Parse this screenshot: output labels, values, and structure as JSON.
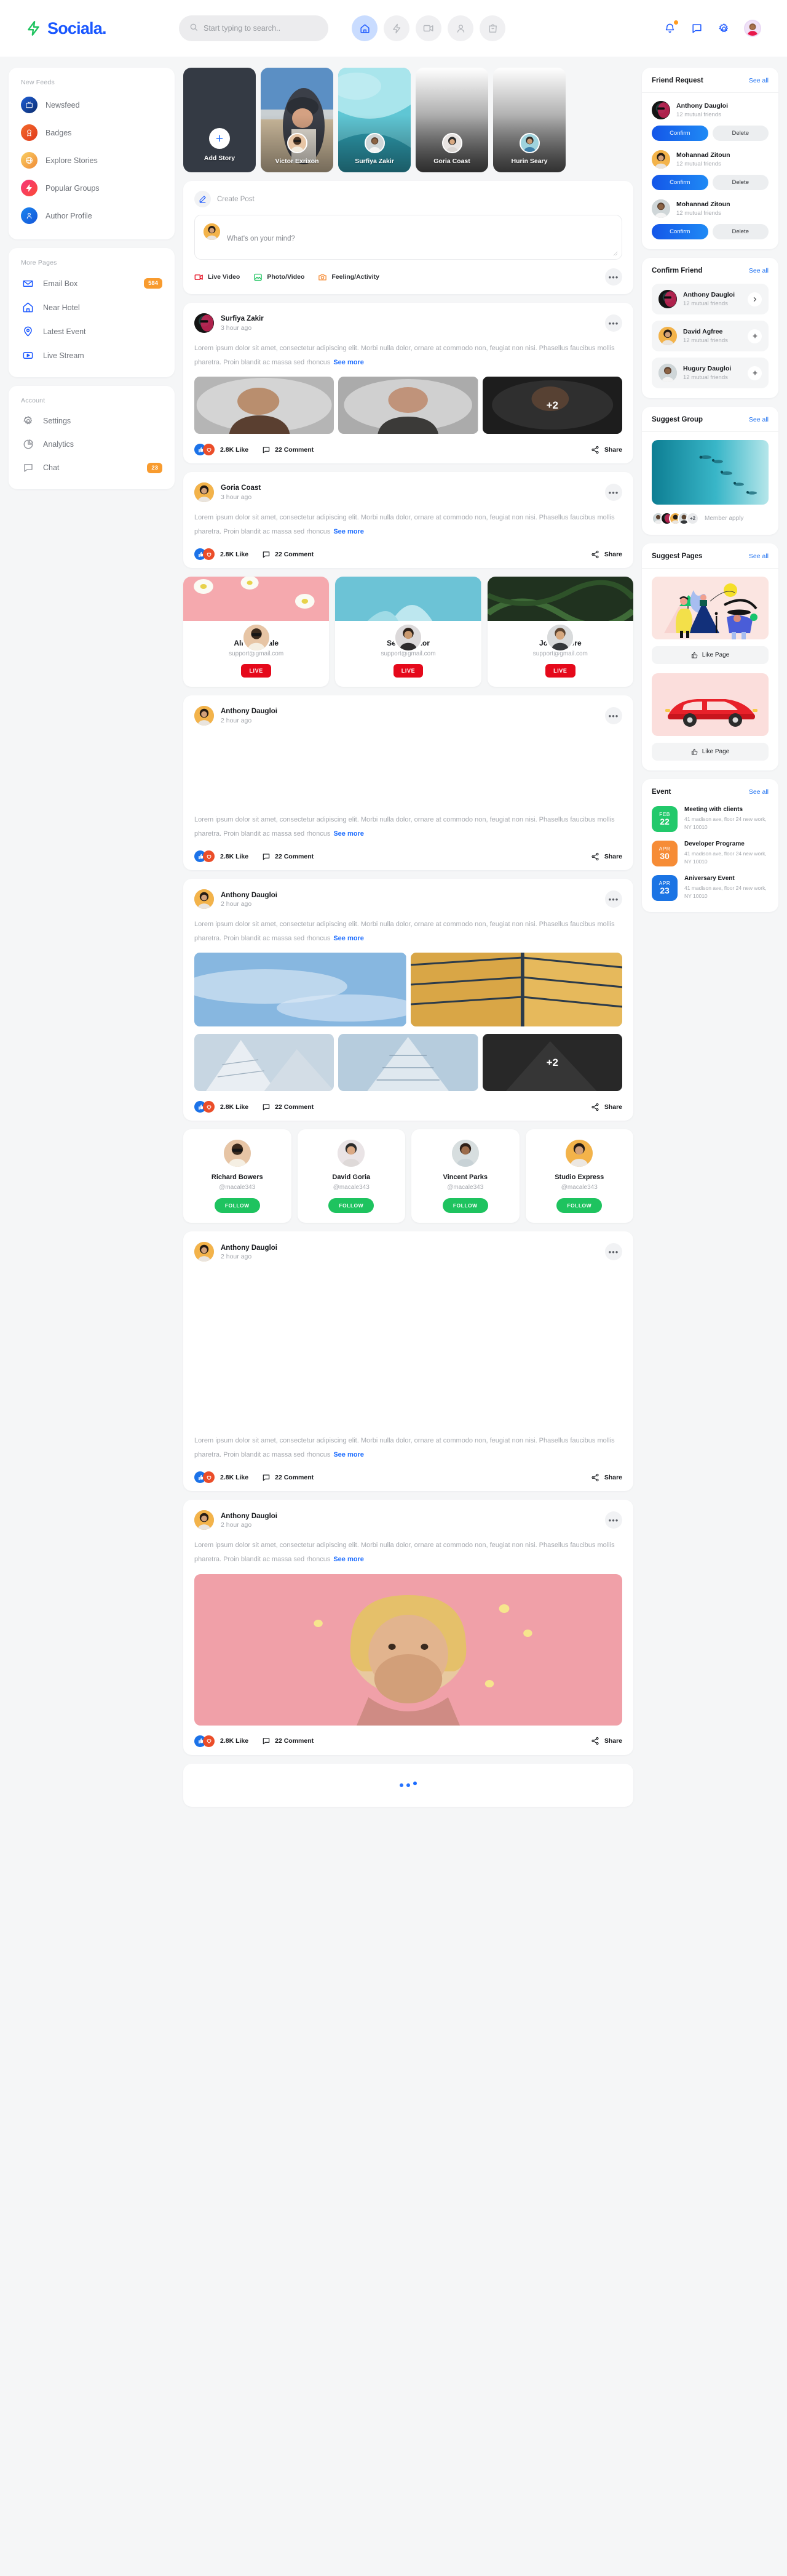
{
  "brand": {
    "name": "Sociala.",
    "logo_icon": "bolt-icon"
  },
  "search": {
    "placeholder": "Start typing to search..",
    "value": "",
    "icon": "search-icon"
  },
  "nav_icons": [
    {
      "name": "home-icon",
      "active": true
    },
    {
      "name": "bolt-icon",
      "active": false
    },
    {
      "name": "video-camera-icon",
      "active": false
    },
    {
      "name": "user-icon",
      "active": false
    },
    {
      "name": "shopping-bag-icon",
      "active": false
    }
  ],
  "header_right": [
    {
      "name": "bell-icon",
      "has_badge": true
    },
    {
      "name": "chat-bubble-icon",
      "has_badge": false
    },
    {
      "name": "gear-icon",
      "has_badge": false
    },
    {
      "name": "profile-avatar",
      "has_badge": false
    }
  ],
  "sidebar": {
    "groups": [
      {
        "title": "New Feeds",
        "items": [
          {
            "label": "Newsfeed",
            "icon": "tv-icon",
            "style": "g-blue"
          },
          {
            "label": "Badges",
            "icon": "award-icon",
            "style": "g-red"
          },
          {
            "label": "Explore Stories",
            "icon": "globe-icon",
            "style": "g-amber"
          },
          {
            "label": "Popular Groups",
            "icon": "bolt-icon",
            "style": "g-pink"
          },
          {
            "label": "Author Profile",
            "icon": "user-icon",
            "style": "g-sky"
          }
        ]
      },
      {
        "title": "More Pages",
        "items": [
          {
            "label": "Email Box",
            "icon": "inbox-icon",
            "count": "584"
          },
          {
            "label": "Near Hotel",
            "icon": "home-icon",
            "count": ""
          },
          {
            "label": "Latest Event",
            "icon": "map-pin-icon",
            "count": ""
          },
          {
            "label": "Live Stream",
            "icon": "play-video-icon",
            "count": ""
          }
        ]
      },
      {
        "title": "Account",
        "items": [
          {
            "label": "Settings",
            "icon": "gear-icon",
            "count": ""
          },
          {
            "label": "Analytics",
            "icon": "pie-chart-icon",
            "count": ""
          },
          {
            "label": "Chat",
            "icon": "chat-bubble-icon",
            "count": "23"
          }
        ]
      }
    ]
  },
  "stories": [
    {
      "name": "Add Story",
      "type": "add",
      "icon": "plus-icon"
    },
    {
      "name": "Victor Exrixon",
      "type": "story",
      "cover": "beach"
    },
    {
      "name": "Surfiya Zakir",
      "type": "story",
      "cover": "wave"
    },
    {
      "name": "Goria Coast",
      "type": "story",
      "cover": "light"
    },
    {
      "name": "Hurin Seary",
      "type": "story",
      "cover": "light2"
    }
  ],
  "create_post": {
    "title": "Create Post",
    "pen_icon": "pencil-icon",
    "placeholder": "What's on your mind?",
    "value": "",
    "actions": [
      {
        "label": "Live Video",
        "icon": "video-camera-icon",
        "color": "#e5091b"
      },
      {
        "label": "Photo/Video",
        "icon": "image-icon",
        "color": "#1ec35f"
      },
      {
        "label": "Feeling/Activity",
        "icon": "camera-icon",
        "color": "#f68c36"
      }
    ],
    "more_icon": "ellipsis-icon"
  },
  "posts": [
    {
      "author": "Surfiya Zakir",
      "time": "3 hour ago",
      "text": "Lorem ipsum dolor sit amet, consectetur adipiscing elit. Morbi nulla dolor, ornare at commodo non, feugiat non nisi. Phasellus faucibus mollis pharetra. Proin blandit ac massa sed rhoncus",
      "see_more": "See more",
      "media_type": "three",
      "extra_count": "+2",
      "likes": "2.8K Like",
      "comments": "22 Comment",
      "share": "Share"
    },
    {
      "author": "Goria Coast",
      "time": "3 hour ago",
      "text": "Lorem ipsum dolor sit amet, consectetur adipiscing elit. Morbi nulla dolor, ornare at commodo non, feugiat non nisi. Phasellus faucibus mollis pharetra. Proin blandit ac massa sed rhoncus",
      "see_more": "See more",
      "media_type": "none",
      "extra_count": "",
      "likes": "2.8K Like",
      "comments": "22 Comment",
      "share": "Share"
    },
    {
      "author": "Anthony Daugloi",
      "time": "2 hour ago",
      "text": "Lorem ipsum dolor sit amet, consectetur adipiscing elit. Morbi nulla dolor, ornare at commodo non, feugiat non nisi. Phasellus faucibus mollis pharetra. Proin blandit ac massa sed rhoncus",
      "see_more": "See more",
      "media_type": "spacer",
      "extra_count": "",
      "likes": "2.8K Like",
      "comments": "22 Comment",
      "share": "Share"
    },
    {
      "author": "Anthony Daugloi",
      "time": "2 hour ago",
      "text": "Lorem ipsum dolor sit amet, consectetur adipiscing elit. Morbi nulla dolor, ornare at commodo non, feugiat non nisi. Phasellus faucibus mollis pharetra. Proin blandit ac massa sed rhoncus",
      "see_more": "See more",
      "media_type": "grid5",
      "extra_count": "+2",
      "likes": "2.8K Like",
      "comments": "22 Comment",
      "share": "Share"
    },
    {
      "author": "Anthony Daugloi",
      "time": "2 hour ago",
      "text": "Lorem ipsum dolor sit amet, consectetur adipiscing elit. Morbi nulla dolor, ornare at commodo non, feugiat non nisi. Phasellus faucibus mollis pharetra. Proin blandit ac massa sed rhoncus",
      "see_more": "See more",
      "media_type": "spacer2",
      "extra_count": "",
      "likes": "2.8K Like",
      "comments": "22 Comment",
      "share": "Share"
    },
    {
      "author": "Anthony Daugloi",
      "time": "2 hour ago",
      "text": "Lorem ipsum dolor sit amet, consectetur adipiscing elit. Morbi nulla dolor, ornare at commodo non, feugiat non nisi. Phasellus faucibus mollis pharetra. Proin blandit ac massa sed rhoncus",
      "see_more": "See more",
      "media_type": "portrait",
      "extra_count": "",
      "likes": "2.8K Like",
      "comments": "22 Comment",
      "share": "Share"
    }
  ],
  "live_cards": [
    {
      "name": "Aliqa Macale",
      "email": "support@gmail.com",
      "badge": "LIVE",
      "cover": "pink"
    },
    {
      "name": "Seary Victor",
      "email": "support@gmail.com",
      "badge": "LIVE",
      "cover": "teal"
    },
    {
      "name": "John Steere",
      "email": "support@gmail.com",
      "badge": "LIVE",
      "cover": "green"
    }
  ],
  "follow_cards": [
    {
      "name": "Richard Bowers",
      "handle": "@macale343",
      "button": "FOLLOW"
    },
    {
      "name": "David Goria",
      "handle": "@macale343",
      "button": "FOLLOW"
    },
    {
      "name": "Vincent Parks",
      "handle": "@macale343",
      "button": "FOLLOW"
    },
    {
      "name": "Studio Express",
      "handle": "@macale343",
      "button": "FOLLOW"
    }
  ],
  "rail": {
    "friend_request": {
      "title": "Friend Request",
      "see_all": "See all",
      "items": [
        {
          "name": "Anthony Daugloi",
          "mutual": "12 mutual friends",
          "confirm": "Confirm",
          "delete": "Delete"
        },
        {
          "name": "Mohannad Zitoun",
          "mutual": "12 mutual friends",
          "confirm": "Confirm",
          "delete": "Delete"
        },
        {
          "name": "Mohannad Zitoun",
          "mutual": "12 mutual friends",
          "confirm": "Confirm",
          "delete": "Delete"
        }
      ]
    },
    "confirm_friend": {
      "title": "Confirm Friend",
      "see_all": "See all",
      "items": [
        {
          "name": "Anthony Daugloi",
          "mutual": "12 mutual friends",
          "action": "chevron-right-icon"
        },
        {
          "name": "David Agfree",
          "mutual": "12 mutual friends",
          "action": "plus-icon"
        },
        {
          "name": "Hugury Daugloi",
          "mutual": "12 mutual friends",
          "action": "plus-icon"
        }
      ]
    },
    "suggest_group": {
      "title": "Suggest Group",
      "see_all": "See all",
      "member_count": "+2",
      "member_label": "Member apply"
    },
    "suggest_pages": {
      "title": "Suggest Pages",
      "see_all": "See all",
      "pages": [
        {
          "button": "Like Page",
          "icon": "thumbs-up-icon",
          "art": "illustration"
        },
        {
          "button": "Like Page",
          "icon": "thumbs-up-icon",
          "art": "car"
        }
      ]
    },
    "event": {
      "title": "Event",
      "see_all": "See all",
      "items": [
        {
          "month": "FEB",
          "day": "22",
          "title": "Meeting with clients",
          "address": "41 madison ave, floor 24 new work, NY 10010",
          "color": "ev-green"
        },
        {
          "month": "APR",
          "day": "30",
          "title": "Developer Programe",
          "address": "41 madison ave, floor 24 new work, NY 10010",
          "color": "ev-orange"
        },
        {
          "month": "APR",
          "day": "23",
          "title": "Aniversary Event",
          "address": "41 madison ave, floor 24 new work, NY 10010",
          "color": "ev-blue"
        }
      ]
    }
  }
}
